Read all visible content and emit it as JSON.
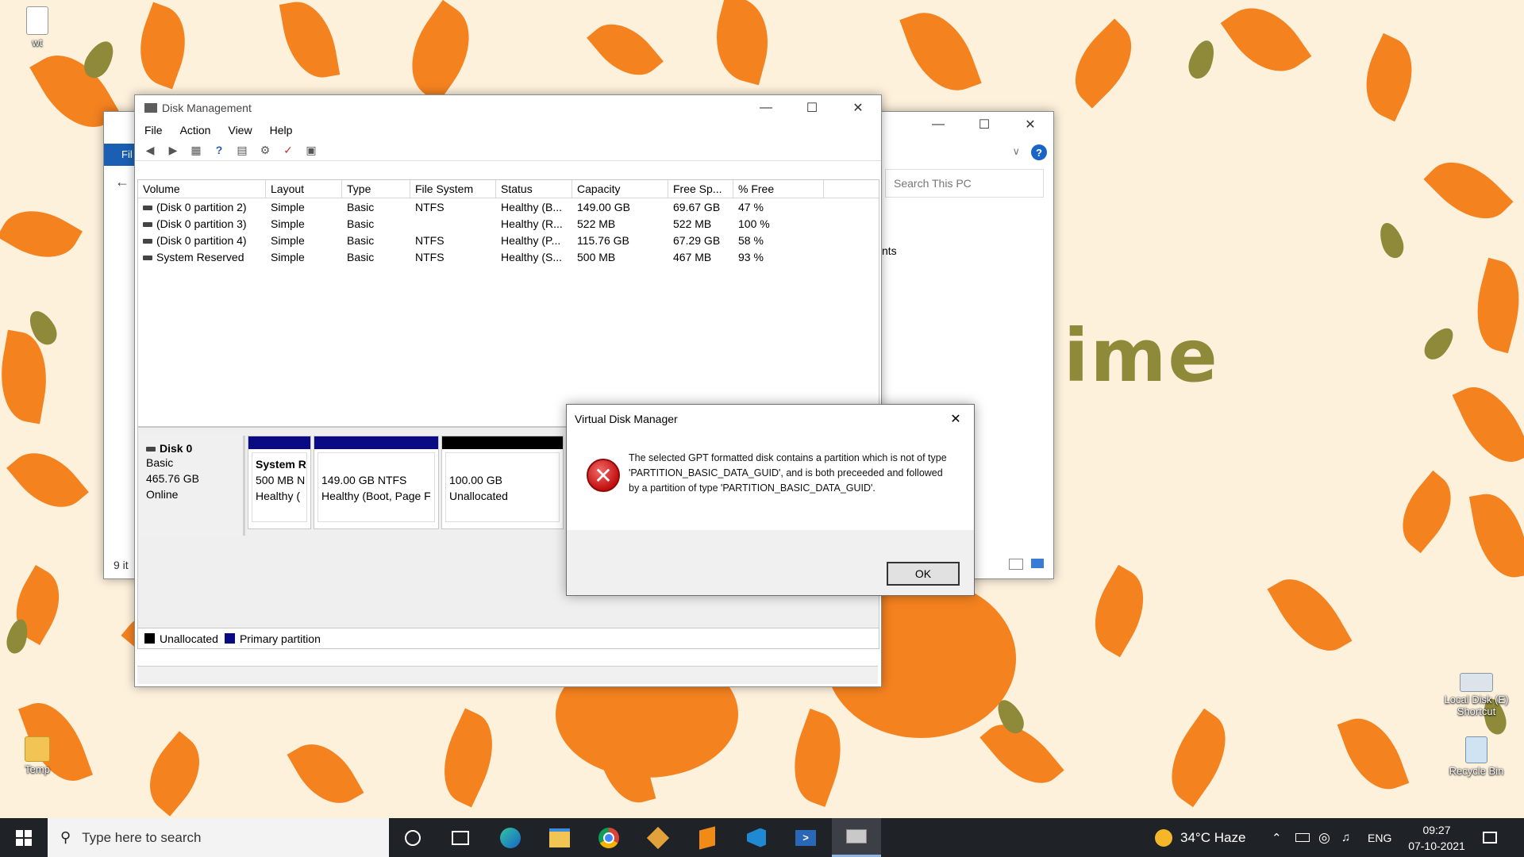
{
  "desktop": {
    "wallpaper_word": "ime",
    "icons": [
      {
        "label": "wt",
        "icon": "text-file-icon"
      },
      {
        "label": "Temp",
        "icon": "folder-icon"
      },
      {
        "label": "Local Disk (E) Shortcut",
        "icon": "drive-shortcut-icon"
      },
      {
        "label": "Recycle Bin",
        "icon": "recycle-bin-icon"
      }
    ]
  },
  "explorer": {
    "search_placeholder": "Search This PC",
    "ribbon_tab": "Fil",
    "partial_text": "nts",
    "status": "9 it"
  },
  "disk_management": {
    "title": "Disk Management",
    "menu": [
      "File",
      "Action",
      "View",
      "Help"
    ],
    "columns": [
      "Volume",
      "Layout",
      "Type",
      "File System",
      "Status",
      "Capacity",
      "Free Sp...",
      "% Free"
    ],
    "volumes": [
      [
        "(Disk 0 partition 2)",
        "Simple",
        "Basic",
        "NTFS",
        "Healthy (B...",
        "149.00 GB",
        "69.67 GB",
        "47 %"
      ],
      [
        "(Disk 0 partition 3)",
        "Simple",
        "Basic",
        "",
        "Healthy (R...",
        "522 MB",
        "522 MB",
        "100 %"
      ],
      [
        "(Disk 0 partition 4)",
        "Simple",
        "Basic",
        "NTFS",
        "Healthy (P...",
        "115.76 GB",
        "67.29 GB",
        "58 %"
      ],
      [
        "System Reserved",
        "Simple",
        "Basic",
        "NTFS",
        "Healthy (S...",
        "500 MB",
        "467 MB",
        "93 %"
      ]
    ],
    "disk": {
      "name": "Disk 0",
      "type": "Basic",
      "size": "465.76 GB",
      "state": "Online"
    },
    "partitions": [
      {
        "line1": "System R",
        "line2": "500 MB N",
        "line3": "Healthy (",
        "bar_color": "#0a0a82"
      },
      {
        "line1": "",
        "line2": "149.00 GB NTFS",
        "line3": "Healthy (Boot, Page F",
        "bar_color": "#0a0a82"
      },
      {
        "line1": "",
        "line2": "100.00 GB",
        "line3": "Unallocated",
        "bar_color": "#000000"
      }
    ],
    "legend": {
      "unallocated": "Unallocated",
      "primary": "Primary partition"
    },
    "legend_colors": {
      "unallocated": "#000000",
      "primary": "#0a0a82"
    }
  },
  "dialog": {
    "title": "Virtual Disk Manager",
    "message": "The selected GPT formatted disk contains a partition which is not of type  'PARTITION_BASIC_DATA_GUID', and is both preceeded and followed by a partition  of type 'PARTITION_BASIC_DATA_GUID'.",
    "ok_label": "OK",
    "icon": "error-icon"
  },
  "taskbar": {
    "search_placeholder": "Type here to search",
    "weather": "34°C  Haze",
    "language": "ENG",
    "time": "09:27",
    "date": "07-10-2021",
    "apps": [
      "task-view-icon",
      "edge-icon",
      "file-explorer-icon",
      "chrome-icon",
      "git-icon",
      "sublime-icon",
      "vscode-icon",
      "powershell-icon",
      "disk-management-icon"
    ]
  }
}
